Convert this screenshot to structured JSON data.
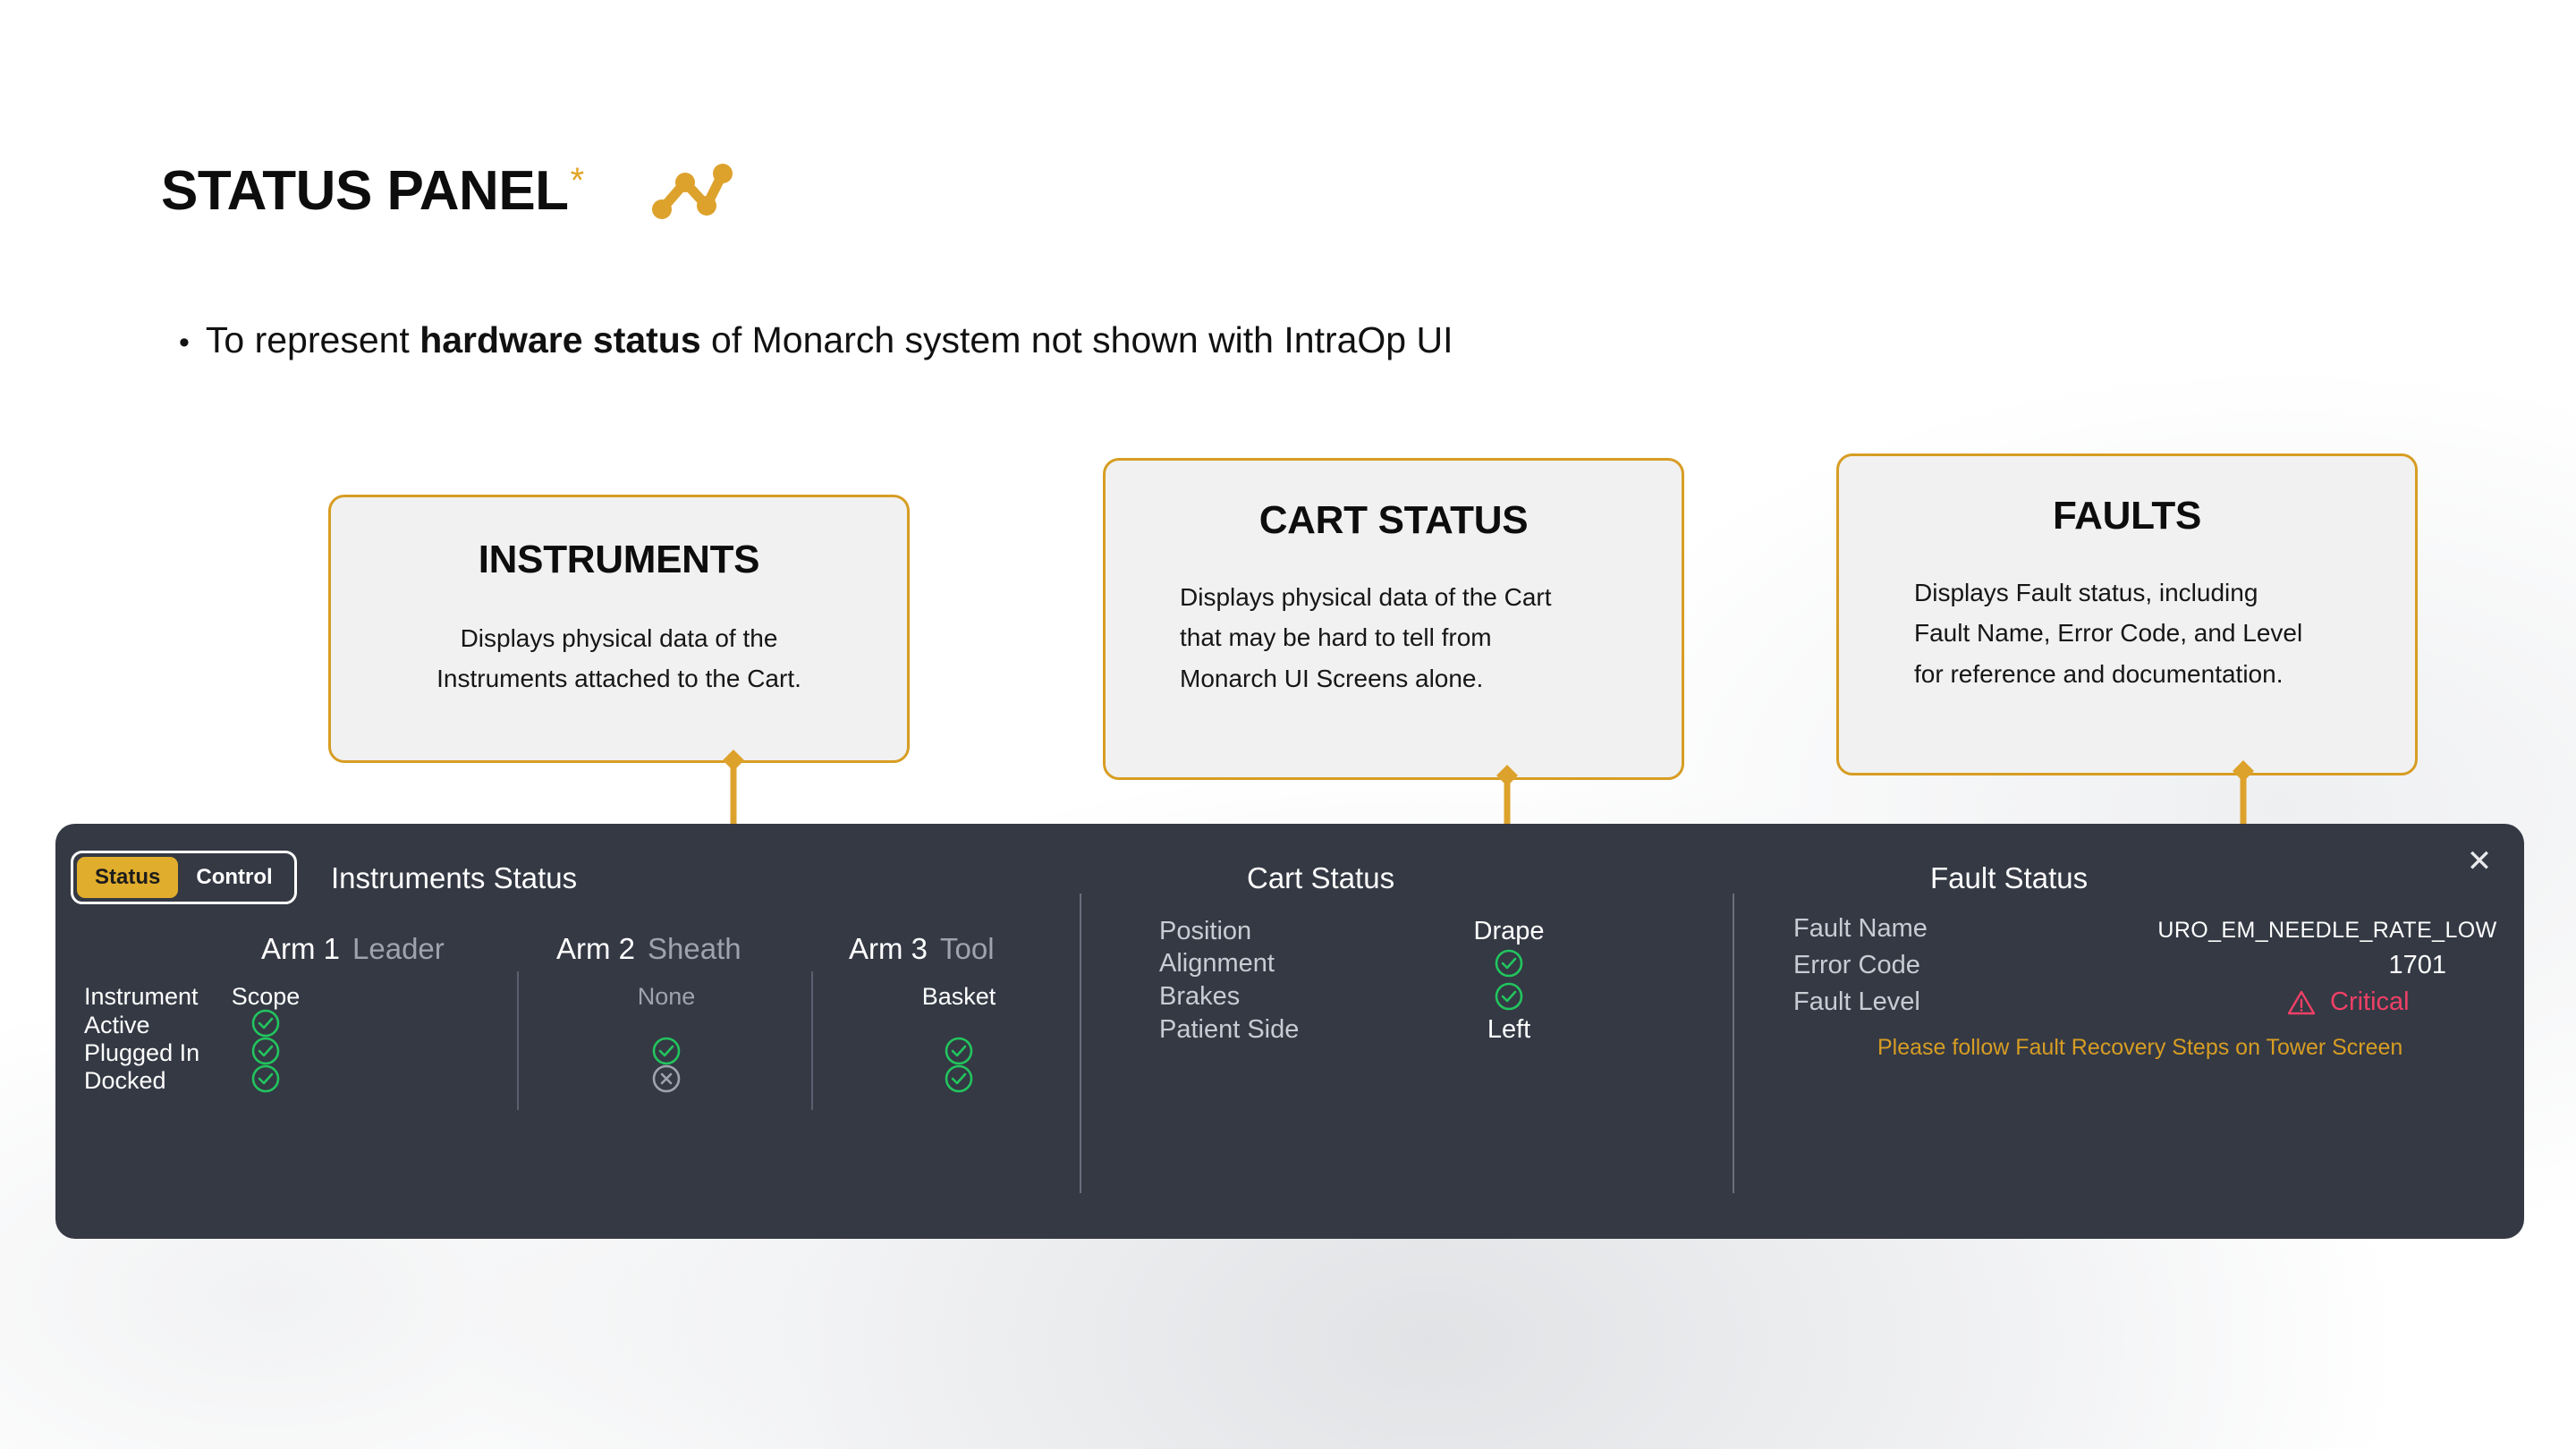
{
  "slide": {
    "title": "STATUS PANEL",
    "title_asterisk": "*",
    "bullet_marker": "•",
    "bullet_prefix": "To represent ",
    "bullet_bold": "hardware status",
    "bullet_suffix": " of Monarch system not shown with IntraOp UI"
  },
  "callouts": [
    {
      "id": "instruments",
      "heading": "INSTRUMENTS",
      "body_line1": "Displays physical data of the",
      "body_line2": "Instruments attached to the Cart."
    },
    {
      "id": "cart",
      "heading": "CART STATUS",
      "body_line1": "Displays physical data of the Cart",
      "body_line2": "that may be hard to tell from",
      "body_line3": "Monarch UI Screens alone."
    },
    {
      "id": "faults",
      "heading": "FAULTS",
      "body_line1": "Displays Fault status, including",
      "body_line2": "Fault Name, Error Code, and Level",
      "body_line3": "for reference and documentation."
    }
  ],
  "panel": {
    "close_label": "✕",
    "toggle": {
      "status": "Status",
      "control": "Control",
      "selected": "Status"
    },
    "instruments": {
      "section_title": "Instruments Status",
      "arms": [
        {
          "num": "Arm 1",
          "type": "Leader",
          "instrument": "Scope",
          "active": "check",
          "plugged_in": "check",
          "docked": "check"
        },
        {
          "num": "Arm 2",
          "type": "Sheath",
          "instrument": "None",
          "active": "",
          "plugged_in": "check",
          "docked": "cross"
        },
        {
          "num": "Arm 3",
          "type": "Tool",
          "instrument": "Basket",
          "active": "",
          "plugged_in": "check",
          "docked": "check"
        }
      ],
      "row_labels": [
        "Instrument",
        "Active",
        "Plugged In",
        "Docked"
      ]
    },
    "cart": {
      "section_title": "Cart Status",
      "rows": [
        {
          "label": "Position",
          "value": "Drape",
          "kind": "text"
        },
        {
          "label": "Alignment",
          "value": "check",
          "kind": "icon"
        },
        {
          "label": "Brakes",
          "value": "check",
          "kind": "icon"
        },
        {
          "label": "Patient Side",
          "value": "Left",
          "kind": "text"
        }
      ]
    },
    "fault": {
      "section_title": "Fault Status",
      "rows": [
        {
          "label": "Fault Name",
          "value": "URO_EM_NEEDLE_RATE_LOW"
        },
        {
          "label": "Error Code",
          "value": "1701"
        },
        {
          "label": "Fault Level",
          "value": "Critical"
        }
      ],
      "note": "Please follow Fault Recovery Steps on Tower Screen"
    }
  },
  "colors": {
    "accent_gold": "#d79d23",
    "toggle_gold": "#e0ad2c",
    "panel_bg": "#343944",
    "check_green": "#22c55e",
    "cross_grey": "#9ea3ad",
    "critical_pink": "#ef4066"
  }
}
